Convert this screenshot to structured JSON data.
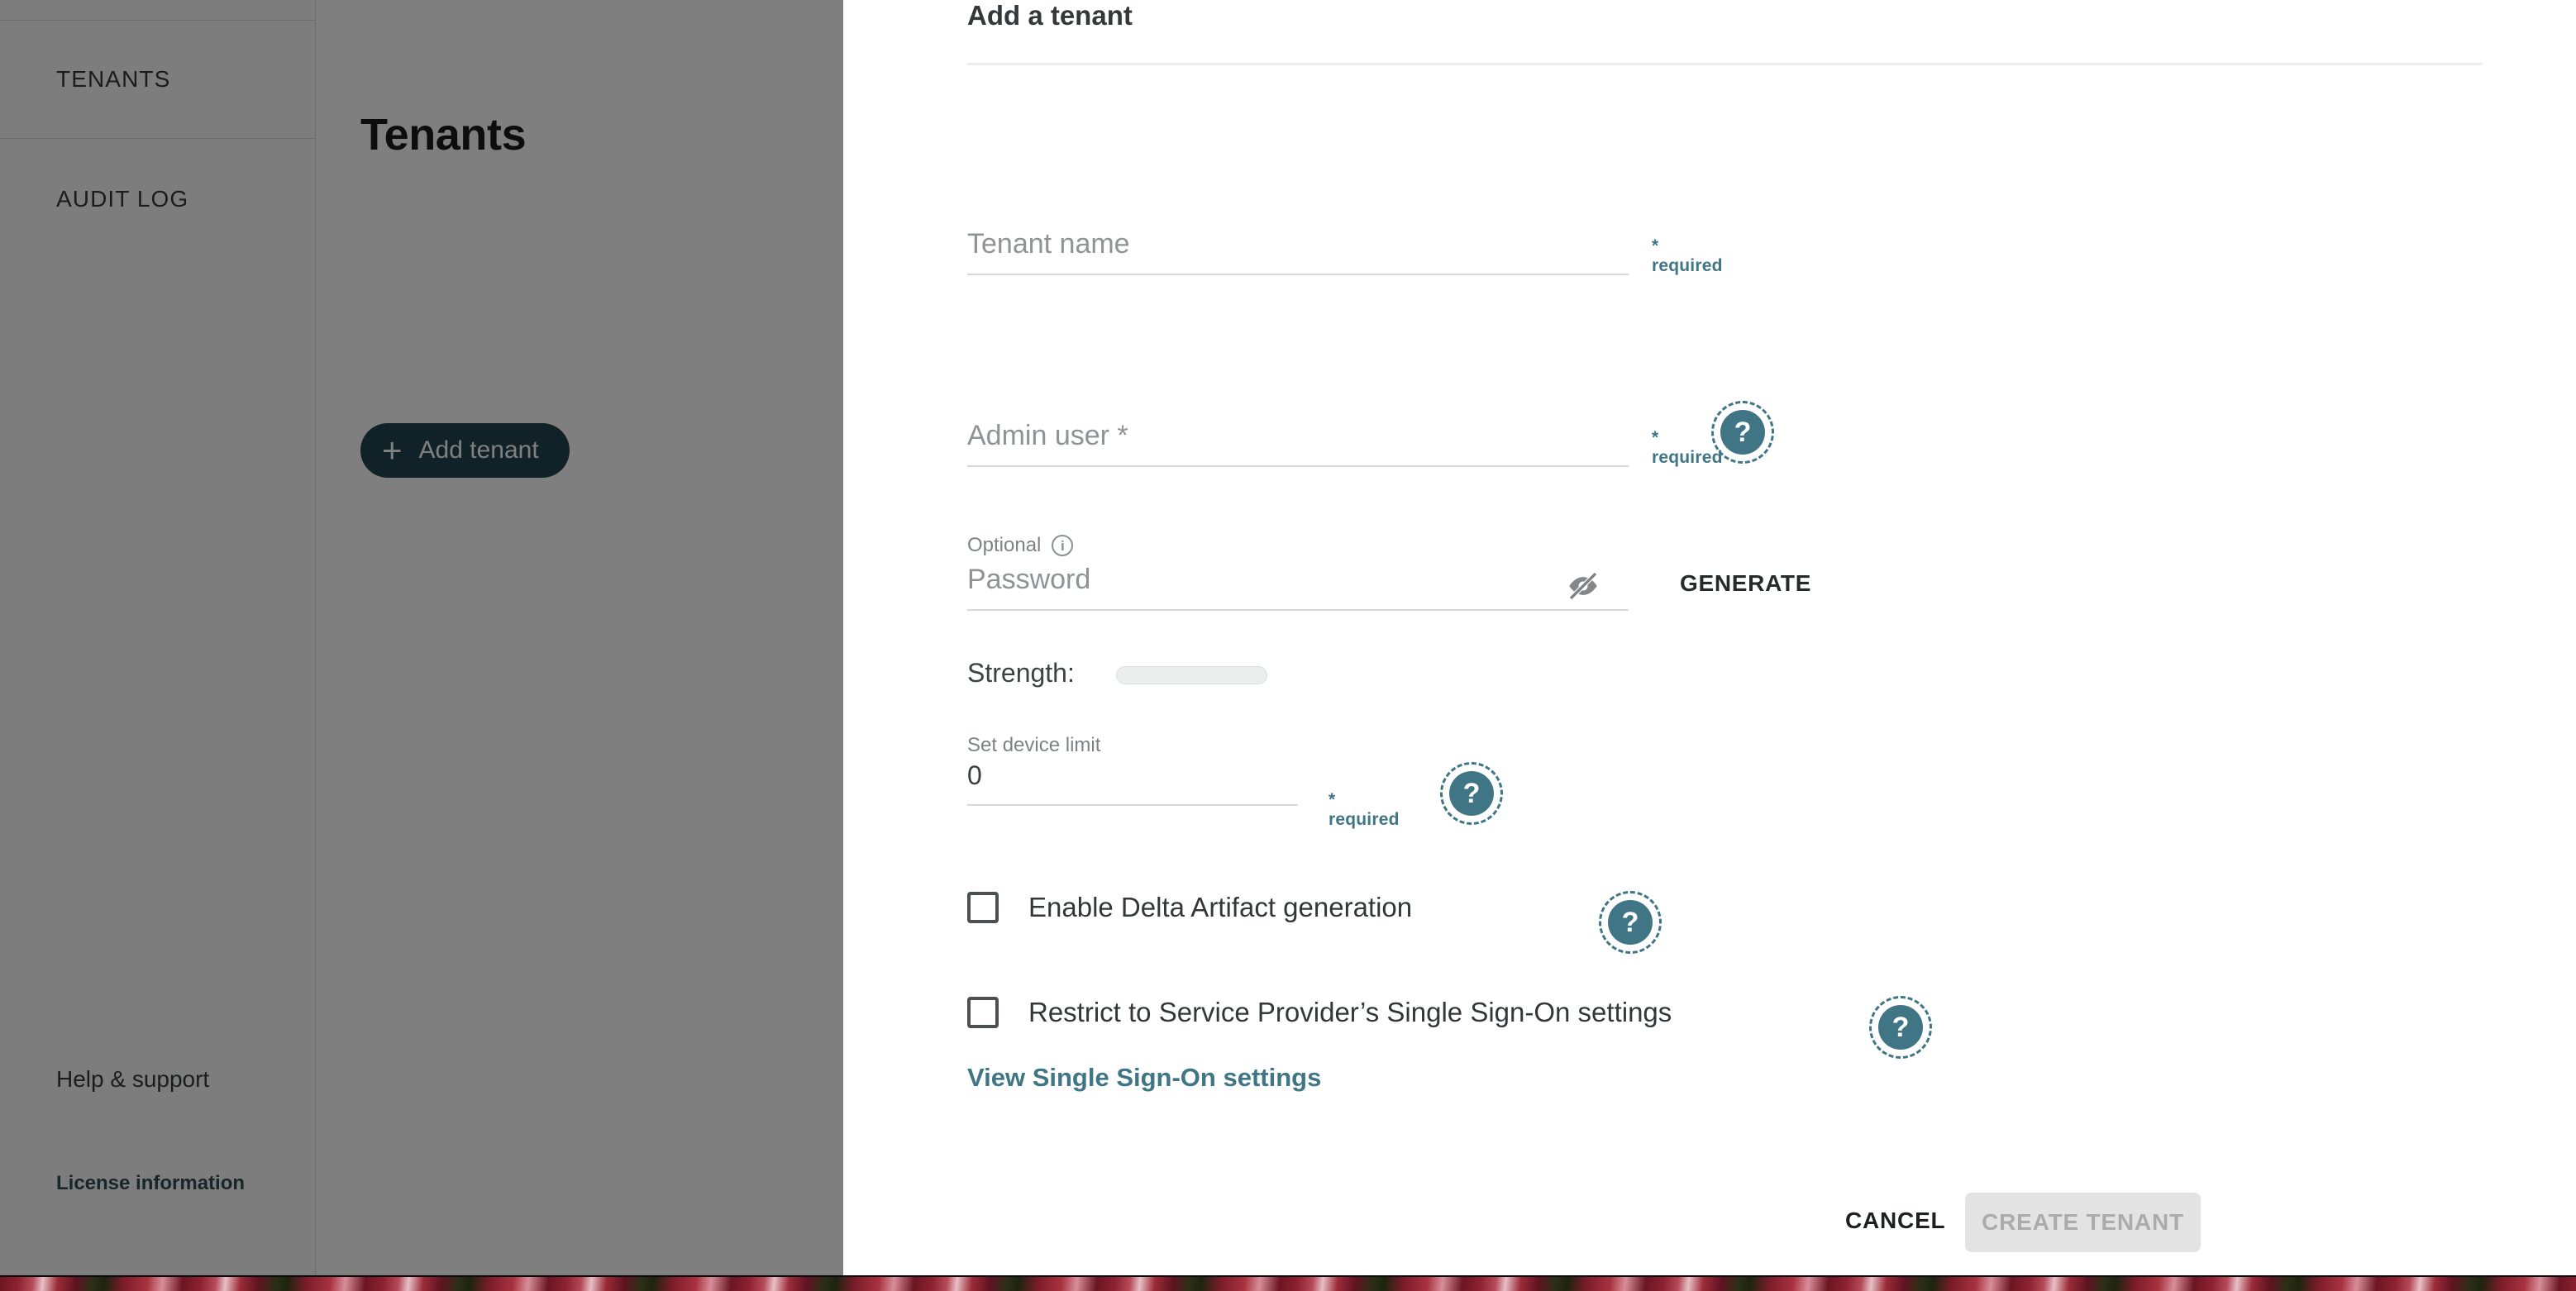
{
  "app": {
    "sidebar": {
      "items": [
        {
          "label": "TENANTS"
        },
        {
          "label": "AUDIT LOG"
        }
      ],
      "help_support": "Help & support",
      "license_information": "License information"
    },
    "page": {
      "title": "Tenants",
      "add_tenant_button": "Add tenant",
      "add_icon": "plus-icon"
    }
  },
  "modal": {
    "title": "Add a tenant",
    "close_icon": "close-icon",
    "fields": {
      "tenant_name": {
        "placeholder": "Tenant name",
        "value": "",
        "required_note": "* required"
      },
      "admin_user": {
        "placeholder": "Admin user *",
        "value": "",
        "required_note": "* required",
        "help_icon": "question-mark-icon"
      },
      "password": {
        "optional_label": "Optional",
        "info_icon": "info-icon",
        "placeholder": "Password",
        "value": "",
        "visibility_icon": "eye-off-icon",
        "generate_label": "GENERATE",
        "strength_label": "Strength:",
        "strength_value": 0
      },
      "device_limit": {
        "label": "Set device limit",
        "value": "0",
        "required_note": "* required",
        "help_icon": "question-mark-icon"
      }
    },
    "checkboxes": [
      {
        "label": "Enable Delta Artifact generation",
        "checked": false,
        "help_icon": "question-mark-icon"
      },
      {
        "label": "Restrict to Service Provider’s Single Sign-On settings",
        "checked": false,
        "help_icon": "question-mark-icon"
      }
    ],
    "sso_link": "View Single Sign-On settings",
    "footer": {
      "cancel_label": "CANCEL",
      "create_label": "CREATE TENANT",
      "create_enabled": false
    },
    "help_badge_glyph": "?"
  },
  "colors": {
    "accent_teal": "#3f7585",
    "button_dark": "#21454f",
    "scrim": "rgba(0,0,0,0.50)",
    "disabled_button_bg": "#e3e3e3",
    "disabled_button_text": "#ababab"
  }
}
